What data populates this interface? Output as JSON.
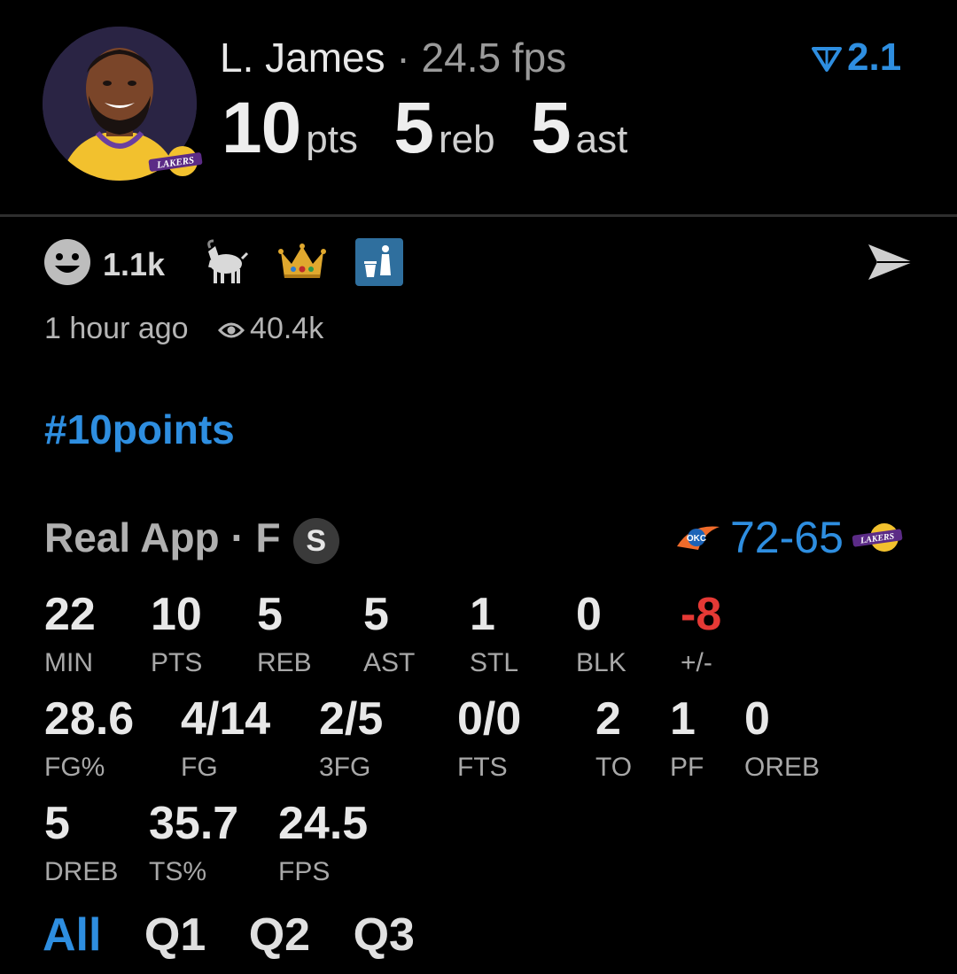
{
  "player": {
    "name": "L. James",
    "separator": "·",
    "fps_label": "24.5 fps",
    "team_logo": "LAKERS",
    "rank_value": "2.1",
    "headline": {
      "pts": "10",
      "pts_unit": "pts",
      "reb": "5",
      "reb_unit": "reb",
      "ast": "5",
      "ast_unit": "ast"
    }
  },
  "reactions": {
    "smile_count": "1.1k",
    "icons": [
      "smile-icon",
      "goat-icon",
      "crown-icon",
      "trash-reaction-icon"
    ],
    "send_icon": "send-icon"
  },
  "meta": {
    "time": "1 hour ago",
    "views": "40.4k"
  },
  "hashtag": "#10points",
  "game": {
    "source": "Real App",
    "separator": "·",
    "position": "F",
    "badge": "S",
    "score": "72-65",
    "away_logo": "OKC",
    "home_logo": "LAKERS"
  },
  "stats": [
    {
      "value": "22",
      "label": "MIN"
    },
    {
      "value": "10",
      "label": "PTS"
    },
    {
      "value": "5",
      "label": "REB"
    },
    {
      "value": "5",
      "label": "AST"
    },
    {
      "value": "1",
      "label": "STL"
    },
    {
      "value": "0",
      "label": "BLK"
    },
    {
      "value": "-8",
      "label": "+/-"
    },
    {
      "value": "28.6",
      "label": "FG%"
    },
    {
      "value": "4/14",
      "label": "FG"
    },
    {
      "value": "2/5",
      "label": "3FG"
    },
    {
      "value": "0/0",
      "label": "FTS"
    },
    {
      "value": "2",
      "label": "TO"
    },
    {
      "value": "1",
      "label": "PF"
    },
    {
      "value": "0",
      "label": "OREB"
    },
    {
      "value": "5",
      "label": "DREB"
    },
    {
      "value": "35.7",
      "label": "TS%"
    },
    {
      "value": "24.5",
      "label": "FPS"
    }
  ],
  "periods": [
    "All",
    "Q1",
    "Q2",
    "Q3"
  ],
  "active_period": "All",
  "colors": {
    "accent": "#2e8ee0",
    "negative": "#e53935",
    "background": "#000000"
  }
}
